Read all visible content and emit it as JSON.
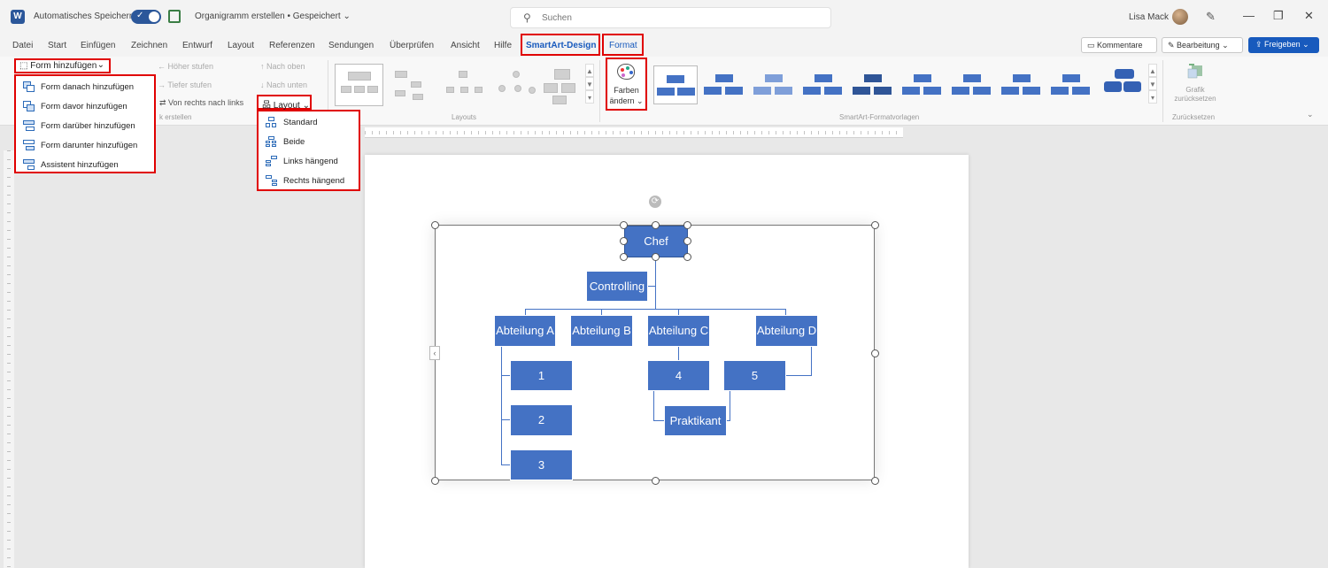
{
  "titlebar": {
    "logo": "W",
    "autosave_label": "Automatisches Speichern",
    "doc_title": "Organigramm erstellen • Gespeichert ⌄",
    "search_placeholder": "Suchen",
    "user_name": "Lisa Mack"
  },
  "tabs": [
    "Datei",
    "Start",
    "Einfügen",
    "Zeichnen",
    "Entwurf",
    "Layout",
    "Referenzen",
    "Sendungen",
    "Überprüfen",
    "Ansicht",
    "Hilfe",
    "SmartArt-Design",
    "Format"
  ],
  "tab_actions": {
    "comments": "Kommentare",
    "editing": "Bearbeitung ⌄",
    "share": "Freigeben ⌄"
  },
  "ribbon": {
    "add_shape": "Form hinzufügen",
    "promote": "Höher stufen",
    "demote": "Tiefer stufen",
    "right_to_left": "Von rechts nach links",
    "move_up": "Nach oben",
    "move_down": "Nach unten",
    "layout_button": "Layout",
    "group_create": "k erstellen",
    "group_layouts": "Layouts",
    "colors_line1": "Farben",
    "colors_line2": "ändern ⌄",
    "group_styles": "SmartArt-Formatvorlagen",
    "reset_line1": "Grafik",
    "reset_line2": "zurücksetzen",
    "group_reset": "Zurücksetzen"
  },
  "add_shape_menu": [
    "Form danach hinzufügen",
    "Form davor hinzufügen",
    "Form darüber hinzufügen",
    "Form darunter hinzufügen",
    "Assistent hinzufügen"
  ],
  "layout_menu": [
    "Standard",
    "Beide",
    "Links hängend",
    "Rechts hängend"
  ],
  "org_chart": {
    "chef": "Chef",
    "controlling": "Controlling",
    "abt_a": "Abteilung A",
    "abt_b": "Abteilung B",
    "abt_c": "Abteilung C",
    "abt_d": "Abteilung D",
    "n1": "1",
    "n2": "2",
    "n3": "3",
    "n4": "4",
    "n5": "5",
    "praktikant": "Praktikant"
  },
  "colors": {
    "accent": "#185abd",
    "node_fill": "#4472c4",
    "highlight": "#e00000"
  }
}
